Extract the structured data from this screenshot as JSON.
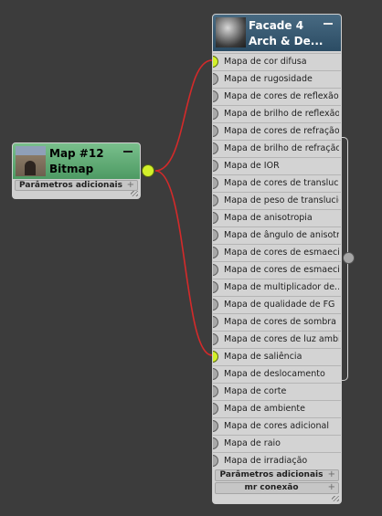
{
  "bitmap_node": {
    "title": "Map #12",
    "subtitle": "Bitmap",
    "footer_label": "Parâmetros adicionais",
    "footer_icon": "+"
  },
  "material_node": {
    "title": "Facade 4",
    "subtitle": "Arch & De...",
    "ports": [
      {
        "label": "Mapa de cor difusa",
        "connected": true
      },
      {
        "label": "Mapa de rugosidade",
        "connected": false
      },
      {
        "label": "Mapa de cores de reflexão",
        "connected": false
      },
      {
        "label": "Mapa de brilho de reflexão",
        "connected": false
      },
      {
        "label": "Mapa de cores de refração",
        "connected": false
      },
      {
        "label": "Mapa de brilho de refração",
        "connected": false
      },
      {
        "label": "Mapa de IOR",
        "connected": false
      },
      {
        "label": "Mapa de cores de translucidez",
        "connected": false
      },
      {
        "label": "Mapa de peso de translucidez",
        "connected": false
      },
      {
        "label": "Mapa de anisotropia",
        "connected": false
      },
      {
        "label": "Mapa de ângulo de anisotropia",
        "connected": false
      },
      {
        "label": "Mapa de cores de esmaecimento",
        "connected": false
      },
      {
        "label": "Mapa de cores de esmaecimento",
        "connected": false
      },
      {
        "label": "Mapa de multiplicador de...",
        "connected": false
      },
      {
        "label": "Mapa de qualidade de FG",
        "connected": false
      },
      {
        "label": "Mapa de cores de sombra",
        "connected": false
      },
      {
        "label": "Mapa de cores de luz ambiente",
        "connected": false
      },
      {
        "label": "Mapa de saliência",
        "connected": true
      },
      {
        "label": "Mapa de deslocamento",
        "connected": false
      },
      {
        "label": "Mapa de corte",
        "connected": false
      },
      {
        "label": "Mapa de ambiente",
        "connected": false
      },
      {
        "label": "Mapa de cores adicional",
        "connected": false
      },
      {
        "label": "Mapa de raio",
        "connected": false
      },
      {
        "label": "Mapa de irradiação",
        "connected": false
      }
    ],
    "footers": [
      {
        "label": "Parâmetros adicionais",
        "icon": "+"
      },
      {
        "label": "mr conexão",
        "icon": "+"
      }
    ]
  },
  "colors": {
    "background": "#3c3c3c",
    "wire": "#d42a2a",
    "active_port": "#d3f02a",
    "bitmap_header": "#5fae77",
    "material_header": "#3a5c74"
  }
}
